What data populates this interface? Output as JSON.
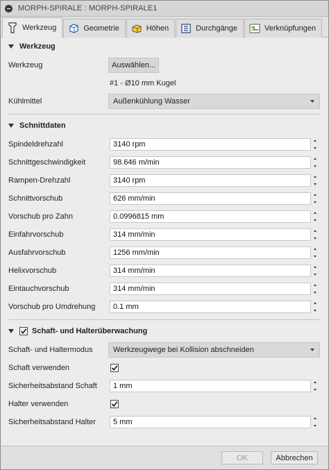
{
  "window": {
    "title": "MORPH-SPIRALE : MORPH-SPIRALE1"
  },
  "tabs": [
    {
      "label": "Werkzeug",
      "icon": "tool-icon",
      "active": true
    },
    {
      "label": "Geometrie",
      "icon": "geometry-cube-icon"
    },
    {
      "label": "Höhen",
      "icon": "heights-icon"
    },
    {
      "label": "Durchgänge",
      "icon": "passes-icon"
    },
    {
      "label": "Verknüpfungen",
      "icon": "linking-icon"
    }
  ],
  "werkzeug": {
    "heading": "Werkzeug",
    "tool_label": "Werkzeug",
    "tool_button": "Auswählen...",
    "tool_name": "#1 - Ø10 mm Kugel",
    "coolant_label": "Kühlmittel",
    "coolant_value": "Außenkühlung Wasser"
  },
  "schnittdaten": {
    "heading": "Schnittdaten",
    "rows": [
      {
        "label": "Spindeldrehzahl",
        "value": "3140 rpm"
      },
      {
        "label": "Schnittgeschwindigkeit",
        "value": "98.646 m/min"
      },
      {
        "label": "Rampen-Drehzahl",
        "value": "3140 rpm"
      },
      {
        "label": "Schnittvorschub",
        "value": "626 mm/min"
      },
      {
        "label": "Vorschub pro Zahn",
        "value": "0.0996815 mm"
      },
      {
        "label": "Einfahrvorschub",
        "value": "314 mm/min"
      },
      {
        "label": "Ausfahrvorschub",
        "value": "1256 mm/min"
      },
      {
        "label": "Helixvorschub",
        "value": "314 mm/min"
      },
      {
        "label": "Eintauchvorschub",
        "value": "314 mm/min"
      },
      {
        "label": "Vorschub pro Umdrehung",
        "value": "0.1 mm"
      }
    ]
  },
  "schaft": {
    "heading": "Schaft- und Halterüberwachung",
    "enabled": true,
    "mode_label": "Schaft- und Haltermodus",
    "mode_value": "Werkzeugwege bei Kollision abschneiden",
    "use_shaft_label": "Schaft verwenden",
    "use_shaft_checked": true,
    "shaft_clearance_label": "Sicherheitsabstand Schaft",
    "shaft_clearance_value": "1 mm",
    "use_holder_label": "Halter verwenden",
    "use_holder_checked": true,
    "holder_clearance_label": "Sicherheitsabstand Halter",
    "holder_clearance_value": "5 mm"
  },
  "footer": {
    "ok": "OK",
    "cancel": "Abbrechen"
  },
  "colors": {
    "background": "#ececec",
    "field": "#ffffff",
    "disabled_text": "#9a9a9a"
  }
}
